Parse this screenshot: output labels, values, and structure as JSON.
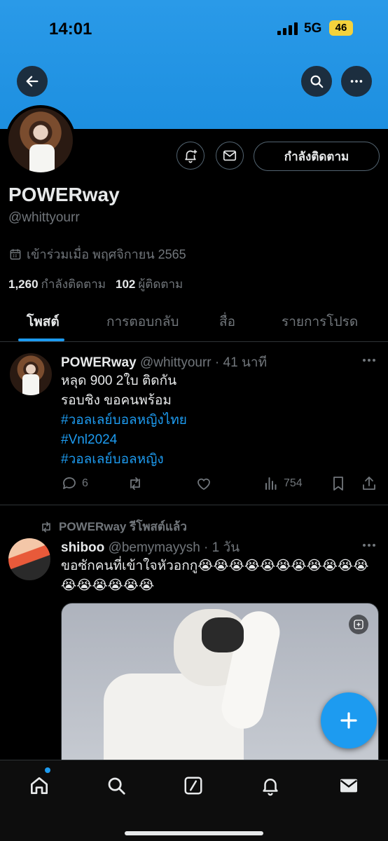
{
  "status_bar": {
    "time": "14:01",
    "network": "5G",
    "battery": "46"
  },
  "profile": {
    "display_name": "POWERway",
    "handle": "@whittyourr",
    "joined": "เข้าร่วมเมื่อ พฤศจิกายน 2565",
    "following_count": "1,260",
    "following_label": "กำลังติดตาม",
    "followers_count": "102",
    "followers_label": "ผู้ติดตาม",
    "follow_button_label": "กำลังติดตาม"
  },
  "tabs": [
    {
      "label": "โพสต์",
      "active": true
    },
    {
      "label": "การตอบกลับ",
      "active": false
    },
    {
      "label": "สื่อ",
      "active": false
    },
    {
      "label": "รายการโปรด",
      "active": false
    }
  ],
  "tweets": [
    {
      "name": "POWERway",
      "meta": "@whittyourr · 41 นาที",
      "lines": [
        "หลุด 900 2ใบ ติดกัน",
        "รอบชิง ขอคนพร้อม"
      ],
      "hashtags": [
        "#วอลเลย์บอลหญิงไทย",
        "#Vnl2024",
        "#วอลเลย์บอลหญิง"
      ],
      "replies": "6",
      "views": "754"
    },
    {
      "retweet_label": "POWERway รีโพสต์แล้ว",
      "name": "shiboo",
      "meta": "@bemymayysh · 1 วัน",
      "text": "ขอซักคนที่เข้าใจหัวอกกู😭😭😭😭😭😭😭😭😭😭😭😭😭😭😭😭😭"
    }
  ],
  "colors": {
    "accent": "#1d9bf0",
    "banner": "#1d8fe0"
  },
  "icons": [
    "back-arrow-icon",
    "search-icon",
    "more-icon",
    "bell-plus-icon",
    "mail-icon",
    "calendar-icon",
    "reply-icon",
    "retweet-icon",
    "like-icon",
    "views-icon",
    "bookmark-icon",
    "share-icon",
    "plus-icon",
    "home-icon",
    "grok-icon",
    "notifications-icon",
    "messages-icon"
  ]
}
